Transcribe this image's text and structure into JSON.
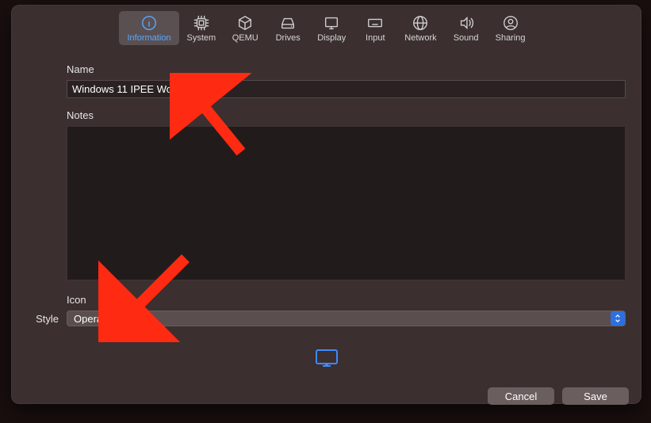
{
  "tabs": [
    {
      "id": "information",
      "label": "Information"
    },
    {
      "id": "system",
      "label": "System"
    },
    {
      "id": "qemu",
      "label": "QEMU"
    },
    {
      "id": "drives",
      "label": "Drives"
    },
    {
      "id": "display",
      "label": "Display"
    },
    {
      "id": "input",
      "label": "Input"
    },
    {
      "id": "network",
      "label": "Network"
    },
    {
      "id": "sound",
      "label": "Sound"
    },
    {
      "id": "sharing",
      "label": "Sharing"
    }
  ],
  "active_tab": "information",
  "labels": {
    "name": "Name",
    "notes": "Notes",
    "icon": "Icon",
    "style": "Style"
  },
  "fields": {
    "name_value": "Windows 11 IPEE World",
    "notes_value": "",
    "style_selected": "Operating System"
  },
  "buttons": {
    "cancel": "Cancel",
    "save": "Save"
  },
  "colors": {
    "accent": "#5aa9ff",
    "select_button": "#2d6fe0",
    "arrow": "#ff2a12"
  }
}
